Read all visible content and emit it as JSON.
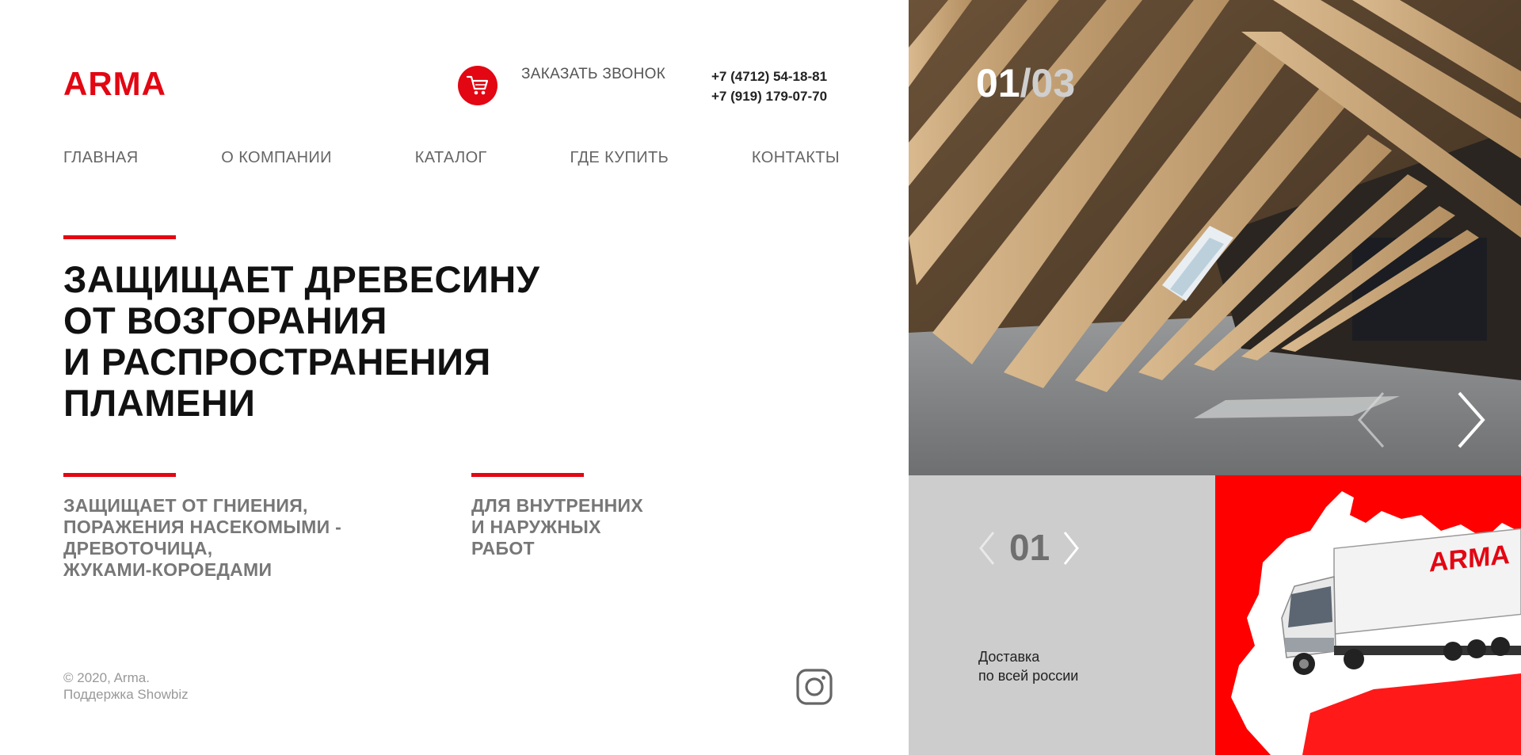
{
  "brand": {
    "logo_text": "ARMA",
    "accent": "#e30613"
  },
  "header": {
    "cart_icon": "cart-icon",
    "callback_label": "ЗАКАЗАТЬ ЗВОНОК",
    "phones": [
      "+7 (4712) 54-18-81",
      "+7 (919) 179-07-70"
    ]
  },
  "nav": {
    "items": [
      {
        "label": "ГЛАВНАЯ"
      },
      {
        "label": "О КОМПАНИИ"
      },
      {
        "label": "КАТАЛОГ"
      },
      {
        "label": "ГДЕ КУПИТЬ"
      },
      {
        "label": "КОНТАКТЫ"
      }
    ]
  },
  "hero": {
    "headline": [
      "ЗАЩИЩАЕТ ДРЕВЕСИНУ",
      "ОТ ВОЗГОРАНИЯ",
      "И РАСПРОСТРАНЕНИЯ",
      "ПЛАМЕНИ"
    ]
  },
  "features": [
    {
      "lines": [
        "ЗАЩИЩАЕТ ОТ ГНИЕНИЯ,",
        "ПОРАЖЕНИЯ НАСЕКОМЫМИ -",
        "ДРЕВОТОЧИЦА,",
        "ЖУКАМИ-КОРОЕДАМИ"
      ]
    },
    {
      "lines": [
        "ДЛЯ ВНУТРЕННИХ",
        "И НАРУЖНЫХ",
        "РАБОТ"
      ]
    }
  ],
  "footer": {
    "copyright": "© 2020, Arma.",
    "support": "Поддержка Showbiz",
    "social_icon": "instagram-icon"
  },
  "slider": {
    "current": "01",
    "separator": "/",
    "total": "03",
    "prev_icon": "chevron-left-icon",
    "next_icon": "chevron-right-icon"
  },
  "mini_slider": {
    "current": "01"
  },
  "delivery": {
    "lines": [
      "Доставка",
      "по всей россии"
    ]
  },
  "truck_brand": "ARMA"
}
